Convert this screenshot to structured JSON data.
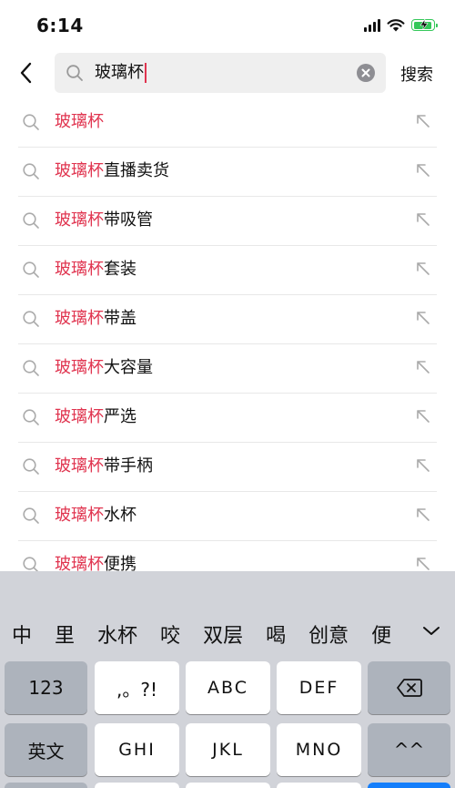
{
  "status_bar": {
    "time": "6:14"
  },
  "search": {
    "query": "玻璃杯",
    "search_button_label": "搜索"
  },
  "suggestions": [
    {
      "highlight": "玻璃杯",
      "rest": ""
    },
    {
      "highlight": "玻璃杯",
      "rest": "直播卖货"
    },
    {
      "highlight": "玻璃杯",
      "rest": "带吸管"
    },
    {
      "highlight": "玻璃杯",
      "rest": "套装"
    },
    {
      "highlight": "玻璃杯",
      "rest": "带盖"
    },
    {
      "highlight": "玻璃杯",
      "rest": "大容量"
    },
    {
      "highlight": "玻璃杯",
      "rest": "严选"
    },
    {
      "highlight": "玻璃杯",
      "rest": "带手柄"
    },
    {
      "highlight": "玻璃杯",
      "rest": "水杯"
    },
    {
      "highlight": "玻璃杯",
      "rest": "便携"
    }
  ],
  "keyboard": {
    "candidates": [
      "中",
      "里",
      "水杯",
      "咬",
      "双层",
      "喝",
      "创意",
      "便"
    ],
    "keys": {
      "numbers": "123",
      "punctuation": ",。?!",
      "abc": "ABC",
      "def": "DEF",
      "english": "英文",
      "ghi": "GHI",
      "jkl": "JKL",
      "mno": "MNO",
      "tone": "^^"
    }
  },
  "colors": {
    "highlight": "#e0344f",
    "battery": "#34c759",
    "keyboard_bg": "#d1d3d9",
    "dark_key": "#adb3bc"
  }
}
